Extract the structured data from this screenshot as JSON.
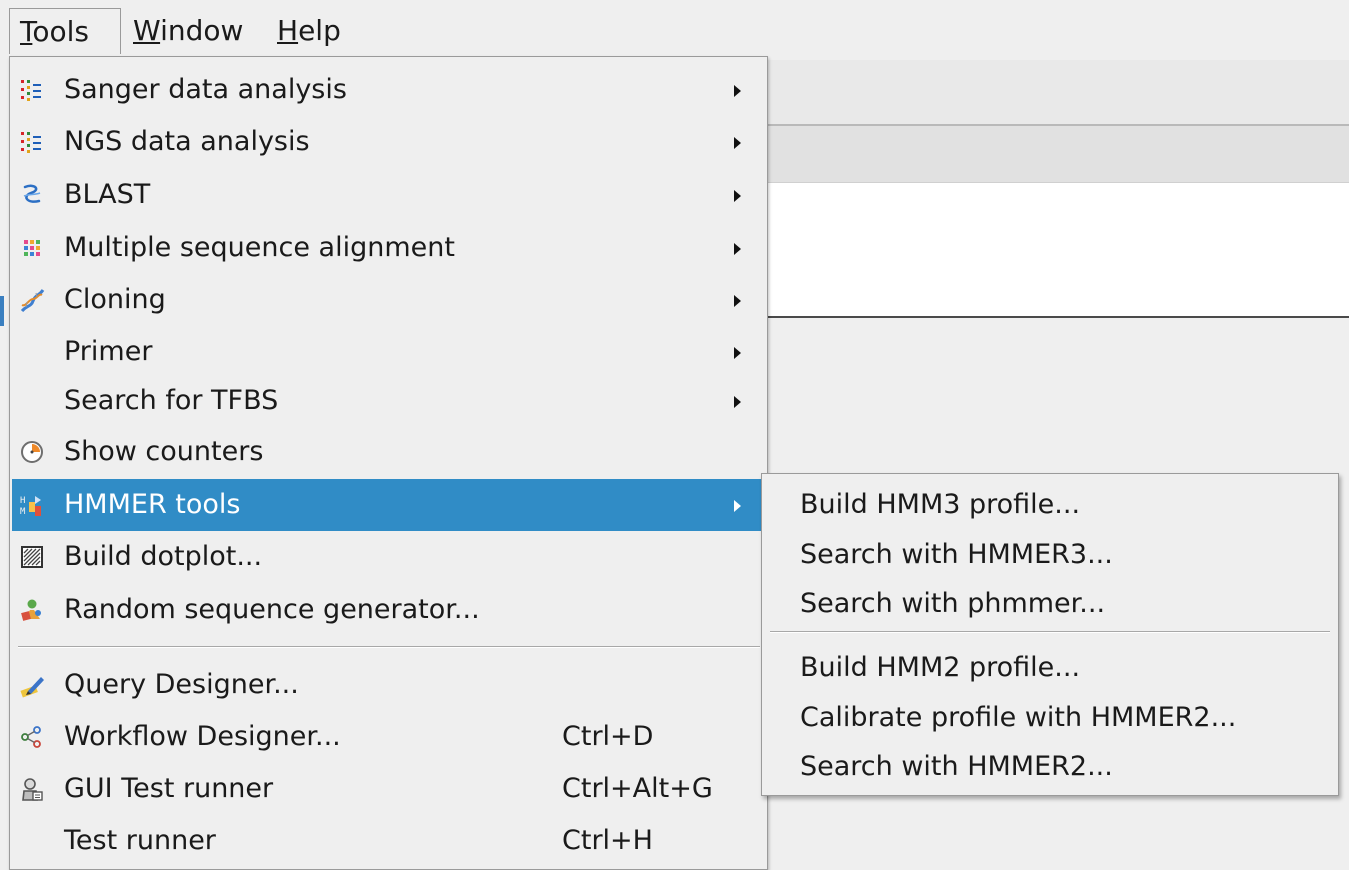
{
  "menubar": {
    "tools": {
      "pre": "",
      "mnemonic": "T",
      "post": "ools"
    },
    "window": {
      "pre": "",
      "mnemonic": "W",
      "post": "indow"
    },
    "help": {
      "pre": "",
      "mnemonic": "H",
      "post": "elp"
    }
  },
  "tools_menu": {
    "items": [
      {
        "label": "Sanger data analysis",
        "icon": "sanger-icon",
        "submenu": true
      },
      {
        "label": "NGS data analysis",
        "icon": "ngs-icon",
        "submenu": true
      },
      {
        "label": "BLAST",
        "icon": "blast-icon",
        "submenu": true
      },
      {
        "label": "Multiple sequence alignment",
        "icon": "msa-icon",
        "submenu": true
      },
      {
        "label": "Cloning",
        "icon": "dna-icon",
        "submenu": true
      },
      {
        "label": "Primer",
        "icon": "",
        "submenu": true
      },
      {
        "label": "Search for TFBS",
        "icon": "",
        "submenu": true
      },
      {
        "label": "Show counters",
        "icon": "counter-icon",
        "submenu": false
      },
      {
        "label": "HMMER tools",
        "icon": "hmmer-icon",
        "submenu": true,
        "highlighted": true
      },
      {
        "label": "Build dotplot...",
        "icon": "dotplot-icon",
        "submenu": false
      },
      {
        "label": "Random sequence generator...",
        "icon": "random-sequence-icon",
        "submenu": false
      },
      {
        "label": "Query Designer...",
        "icon": "query-designer-icon",
        "submenu": false
      },
      {
        "label": "Workflow Designer...",
        "icon": "workflow-icon",
        "shortcut": "Ctrl+D"
      },
      {
        "label": "GUI Test runner",
        "icon": "gui-test-icon",
        "shortcut": "Ctrl+Alt+G"
      },
      {
        "label": "Test runner",
        "icon": "",
        "shortcut": "Ctrl+H"
      }
    ]
  },
  "hmmer_submenu": {
    "items": [
      {
        "label": "Build HMM3 profile..."
      },
      {
        "label": "Search with HMMER3..."
      },
      {
        "label": "Search with phmmer..."
      },
      {
        "label": "Build HMM2 profile..."
      },
      {
        "label": "Calibrate profile with HMMER2..."
      },
      {
        "label": "Search with HMMER2..."
      }
    ]
  },
  "colors": {
    "highlight": "#308cc6",
    "menu_bg": "#efefef"
  }
}
